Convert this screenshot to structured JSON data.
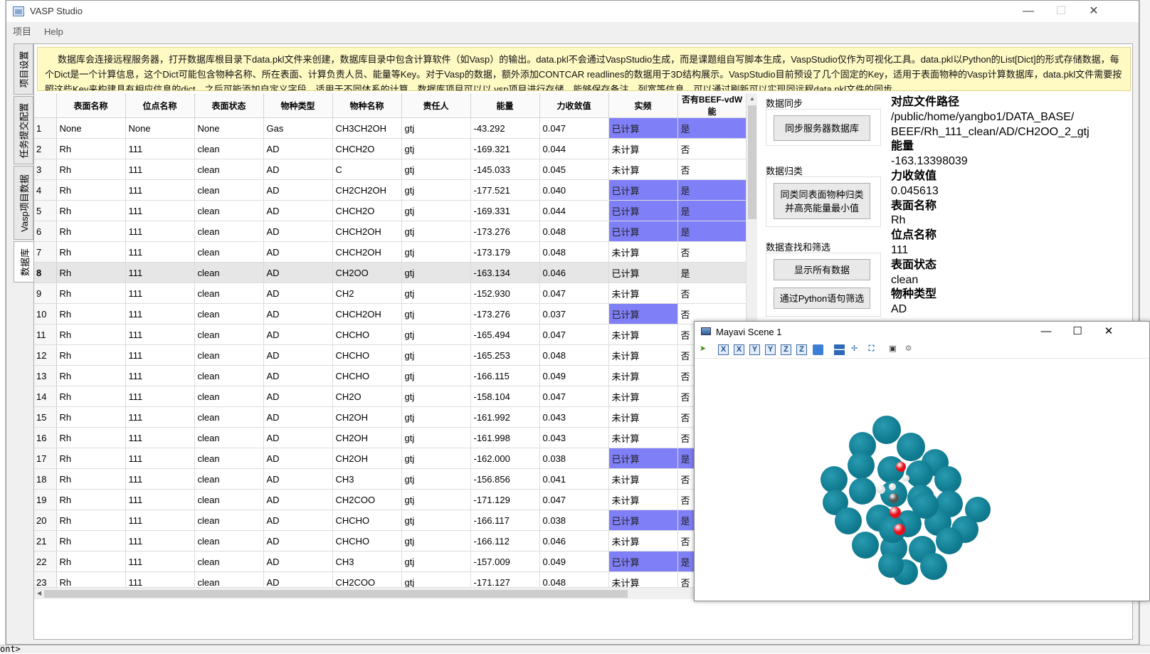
{
  "window": {
    "title": "VASP Studio",
    "controls": {
      "minimize": "—",
      "maximize": "☐",
      "close": "✕"
    }
  },
  "menu": [
    "项目",
    "Help"
  ],
  "vertical_tabs": [
    "项目设置",
    "任务提交配置",
    "Vasp项目数据",
    "数据库"
  ],
  "notice": "数据库会连接远程服务器，打开数据库根目录下data.pkl文件来创建，数据库目录中包含计算软件（如Vasp）的输出。data.pkl不会通过VaspStudio生成，而是课题组自写脚本生成，VaspStudio仅作为可视化工具。data.pkl以Python的List[Dict]的形式存储数据，每个Dict是一个计算信息，这个Dict可能包含物种名称、所在表面、计算负责人员、能量等Key。对于Vasp的数据，额外添加CONTCAR readlines的数据用于3D结构展示。VaspStudio目前预设了几个固定的Key，适用于表面物种的Vasp计算数据库，data.pkl文件需要按照这些Key来构建具有相应信息的dict。之后可能添加自定义字段，适用于不同体系的计算。数据库项目可以以.vsp项目进行存储，能够保存备注、列宽等信息，可以通过刷新可以实现同远程data.pkl文件的同步。",
  "table": {
    "columns": [
      "表面名称",
      "位点名称",
      "表面状态",
      "物种类型",
      "物种名称",
      "责任人",
      "能量",
      "力收敛值",
      "实频",
      "否有BEEF-vdW能"
    ],
    "rows": [
      [
        "1",
        "None",
        "None",
        "None",
        "Gas",
        "CH3CH2OH",
        "gtj",
        "-43.292",
        "0.047",
        "已计算",
        "是"
      ],
      [
        "2",
        "Rh",
        "111",
        "clean",
        "AD",
        "CHCH2O",
        "gtj",
        "-169.321",
        "0.044",
        "未计算",
        "否"
      ],
      [
        "3",
        "Rh",
        "111",
        "clean",
        "AD",
        "C",
        "gtj",
        "-145.033",
        "0.045",
        "未计算",
        "否"
      ],
      [
        "4",
        "Rh",
        "111",
        "clean",
        "AD",
        "CH2CH2OH",
        "gtj",
        "-177.521",
        "0.040",
        "已计算",
        "是"
      ],
      [
        "5",
        "Rh",
        "111",
        "clean",
        "AD",
        "CHCH2O",
        "gtj",
        "-169.331",
        "0.044",
        "已计算",
        "是"
      ],
      [
        "6",
        "Rh",
        "111",
        "clean",
        "AD",
        "CHCH2OH",
        "gtj",
        "-173.276",
        "0.048",
        "已计算",
        "是"
      ],
      [
        "7",
        "Rh",
        "111",
        "clean",
        "AD",
        "CHCH2OH",
        "gtj",
        "-173.179",
        "0.048",
        "未计算",
        "否"
      ],
      [
        "8",
        "Rh",
        "111",
        "clean",
        "AD",
        "CH2OO",
        "gtj",
        "-163.134",
        "0.046",
        "已计算",
        "是"
      ],
      [
        "9",
        "Rh",
        "111",
        "clean",
        "AD",
        "CH2",
        "gtj",
        "-152.930",
        "0.047",
        "未计算",
        "否"
      ],
      [
        "10",
        "Rh",
        "111",
        "clean",
        "AD",
        "CHCH2OH",
        "gtj",
        "-173.276",
        "0.037",
        "已计算",
        "否"
      ],
      [
        "11",
        "Rh",
        "111",
        "clean",
        "AD",
        "CHCHO",
        "gtj",
        "-165.494",
        "0.047",
        "未计算",
        "否"
      ],
      [
        "12",
        "Rh",
        "111",
        "clean",
        "AD",
        "CHCHO",
        "gtj",
        "-165.253",
        "0.048",
        "未计算",
        "否"
      ],
      [
        "13",
        "Rh",
        "111",
        "clean",
        "AD",
        "CHCHO",
        "gtj",
        "-166.115",
        "0.049",
        "未计算",
        "否"
      ],
      [
        "14",
        "Rh",
        "111",
        "clean",
        "AD",
        "CH2O",
        "gtj",
        "-158.104",
        "0.047",
        "未计算",
        "否"
      ],
      [
        "15",
        "Rh",
        "111",
        "clean",
        "AD",
        "CH2OH",
        "gtj",
        "-161.992",
        "0.043",
        "未计算",
        "否"
      ],
      [
        "16",
        "Rh",
        "111",
        "clean",
        "AD",
        "CH2OH",
        "gtj",
        "-161.998",
        "0.043",
        "未计算",
        "否"
      ],
      [
        "17",
        "Rh",
        "111",
        "clean",
        "AD",
        "CH2OH",
        "gtj",
        "-162.000",
        "0.038",
        "已计算",
        "是"
      ],
      [
        "18",
        "Rh",
        "111",
        "clean",
        "AD",
        "CH3",
        "gtj",
        "-156.856",
        "0.041",
        "未计算",
        "否"
      ],
      [
        "19",
        "Rh",
        "111",
        "clean",
        "AD",
        "CH2COO",
        "gtj",
        "-171.129",
        "0.047",
        "未计算",
        "否"
      ],
      [
        "20",
        "Rh",
        "111",
        "clean",
        "AD",
        "CHCHO",
        "gtj",
        "-166.117",
        "0.038",
        "已计算",
        "是"
      ],
      [
        "21",
        "Rh",
        "111",
        "clean",
        "AD",
        "CHCHO",
        "gtj",
        "-166.112",
        "0.046",
        "未计算",
        "否"
      ],
      [
        "22",
        "Rh",
        "111",
        "clean",
        "AD",
        "CH3",
        "gtj",
        "-157.009",
        "0.049",
        "已计算",
        "是"
      ],
      [
        "23",
        "Rh",
        "111",
        "clean",
        "AD",
        "CH2COO",
        "gtj",
        "-171.127",
        "0.048",
        "未计算",
        "否"
      ]
    ],
    "highlighted_rows": [
      "1",
      "4",
      "5",
      "6",
      "10",
      "17",
      "20",
      "22"
    ],
    "selected_row": "8",
    "highlight_color": "#7f7ff7"
  },
  "side_panel": {
    "sync_title": "数据同步",
    "sync_button": "同步服务器数据库",
    "group_title": "数据归类",
    "group_button_line1": "同类同表面物种归类",
    "group_button_line2": "并高亮能量最小值",
    "filter_title": "数据查找和筛选",
    "show_all_button": "显示所有数据",
    "python_filter_button": "通过Python语句筛选"
  },
  "info": {
    "path_label": "对应文件路径",
    "path_line1": "/public/home/yangbo1/DATA_BASE/",
    "path_line2": "BEEF/Rh_111_clean/AD/CH2OO_2_gtj",
    "energy_label": "能量",
    "energy_value": "-163.13398039",
    "force_label": "力收敛值",
    "force_value": "0.045613",
    "surface_label": "表面名称",
    "surface_value": "Rh",
    "site_label": "位点名称",
    "site_value": "111",
    "state_label": "表面状态",
    "state_value": "clean",
    "type_label": "物种类型",
    "type_value": "AD"
  },
  "mayavi": {
    "title": "Mayavi Scene 1",
    "controls": {
      "minimize": "—",
      "maximize": "☐",
      "close": "✕"
    },
    "toolbar_axes": [
      "X",
      "X",
      "Y",
      "Y",
      "Z",
      "Z"
    ],
    "atom_colors": {
      "rh": "#117d92",
      "oxygen": "#e8101a",
      "carbon": "#555555",
      "hydrogen": "#e4e4e4"
    }
  },
  "background_text": "ont>"
}
